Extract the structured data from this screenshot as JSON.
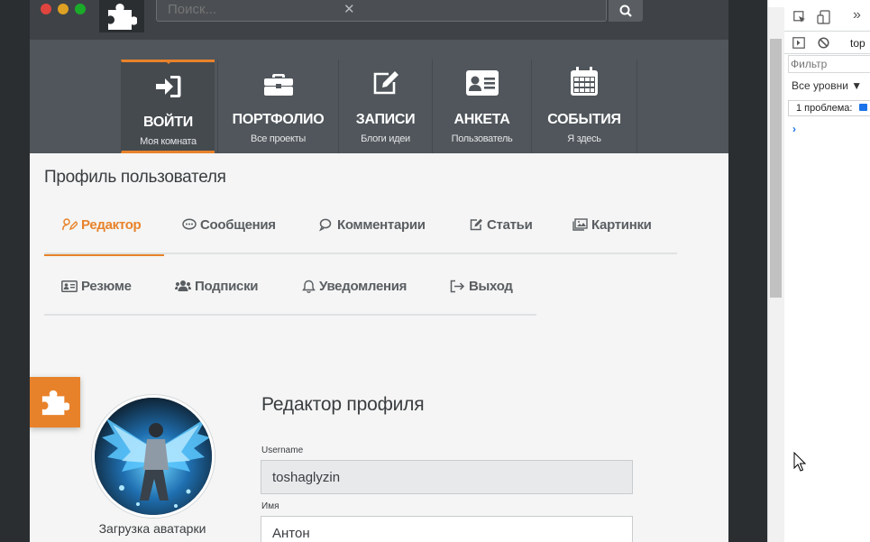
{
  "colors": {
    "accent": "#e8822a",
    "nav_bg": "#50565b",
    "topbar_bg": "#3f4347",
    "page_bg": "#f4f5f4",
    "dark_bg": "#2b2e31"
  },
  "topbar": {
    "window_dots": [
      "close",
      "minimize",
      "maximize"
    ],
    "search_placeholder": "Поиск...",
    "search_clear": "✕",
    "search_icon": "search-icon",
    "logo_icon": "puzzle-icon"
  },
  "nav": {
    "items": [
      {
        "title": "ВОЙТИ",
        "subtitle": "Моя комната",
        "icon": "sign-in-icon",
        "active": true
      },
      {
        "title": "ПОРТФОЛИО",
        "subtitle": "Все проекты",
        "icon": "briefcase-icon",
        "active": false
      },
      {
        "title": "ЗАПИСИ",
        "subtitle": "Блоги идеи",
        "icon": "edit-icon",
        "active": false
      },
      {
        "title": "АНКЕТА",
        "subtitle": "Пользователь",
        "icon": "id-card-icon",
        "active": false
      },
      {
        "title": "СОБЫТИЯ",
        "subtitle": "Я здесь",
        "icon": "calendar-icon",
        "active": false
      }
    ]
  },
  "profile": {
    "title": "Профиль пользователя",
    "tabs_row1": [
      {
        "label": "Редактор",
        "icon": "user-edit-icon",
        "active": true
      },
      {
        "label": "Сообщения",
        "icon": "comment-dots-icon",
        "active": false
      },
      {
        "label": "Комментарии",
        "icon": "comments-icon",
        "active": false
      },
      {
        "label": "Статьи",
        "icon": "edit-icon",
        "active": false
      },
      {
        "label": "Картинки",
        "icon": "images-icon",
        "active": false
      }
    ],
    "tabs_row2": [
      {
        "label": "Резюме",
        "icon": "address-card-icon",
        "active": false
      },
      {
        "label": "Подписки",
        "icon": "users-icon",
        "active": false
      },
      {
        "label": "Уведомления",
        "icon": "bell-icon",
        "active": false
      },
      {
        "label": "Выход",
        "icon": "sign-out-icon",
        "active": false
      }
    ]
  },
  "avatar": {
    "caption": "Загрузка аватарки"
  },
  "editor": {
    "title": "Редактор профиля",
    "username_label": "Username",
    "username_value": "toshaglyzin",
    "name_label": "Имя",
    "name_value": "Антон"
  },
  "devtools": {
    "context": "top",
    "filter_placeholder": "Фильтр",
    "levels": "Все уровни ▼",
    "issues": "1 проблема:",
    "prompt": "›"
  }
}
